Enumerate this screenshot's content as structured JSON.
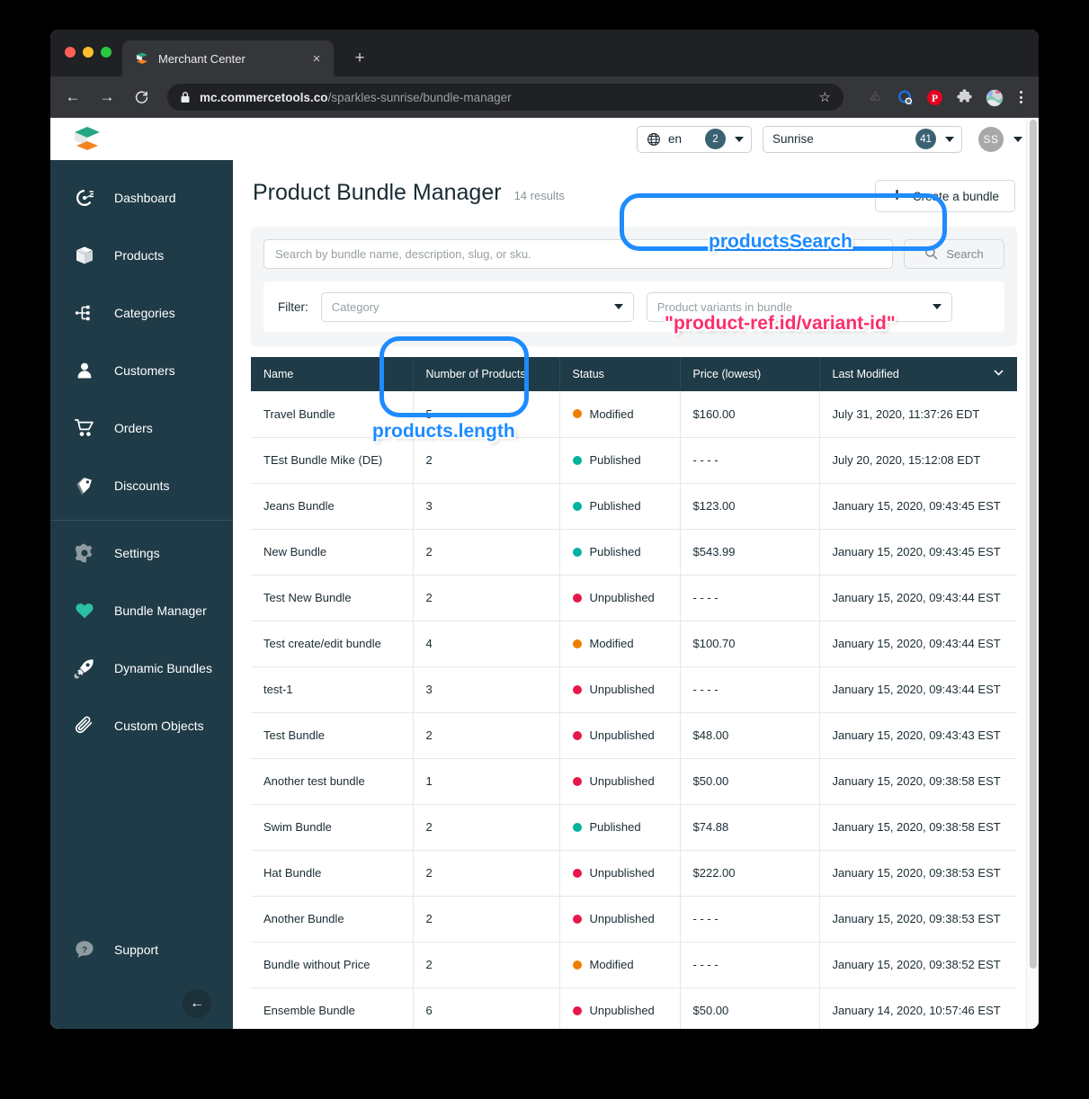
{
  "browser": {
    "tab": {
      "title": "Merchant Center",
      "favicon": "commercetools-logo-icon",
      "close": "×"
    },
    "new_tab_label": "+",
    "nav": {
      "back": "←",
      "forward": "→",
      "reload": "↻"
    },
    "url": {
      "domain": "mc.commercetools.co",
      "path": "/sparkles-sunrise/bundle-manager"
    },
    "extensions": [
      "recycle-icon",
      "search-lens-icon",
      "pinterest-icon",
      "puzzle-extension-icon",
      "profile-avatar-icon"
    ],
    "star_icon": "☆"
  },
  "app_header": {
    "logo": "commercetools-logo",
    "language": {
      "value": "en",
      "count": "2",
      "icon": "globe-icon"
    },
    "project": {
      "value": "Sunrise",
      "count": "41"
    },
    "user": {
      "initials": "SS"
    }
  },
  "sidebar": {
    "items": [
      {
        "label": "Dashboard",
        "icon": "gauge-icon",
        "active": false
      },
      {
        "label": "Products",
        "icon": "box-icon",
        "active": false
      },
      {
        "label": "Categories",
        "icon": "tree-icon",
        "active": false
      },
      {
        "label": "Customers",
        "icon": "person-icon",
        "active": false
      },
      {
        "label": "Orders",
        "icon": "cart-icon",
        "active": false
      },
      {
        "label": "Discounts",
        "icon": "tags-icon",
        "active": false
      },
      {
        "label": "Settings",
        "icon": "gear-icon",
        "active": false
      },
      {
        "label": "Bundle Manager",
        "icon": "heart-icon",
        "active": true
      },
      {
        "label": "Dynamic Bundles",
        "icon": "rocket-icon",
        "active": false
      },
      {
        "label": "Custom Objects",
        "icon": "paperclip-icon",
        "active": false
      }
    ],
    "support": {
      "label": "Support",
      "icon": "question-bubble-icon"
    },
    "collapse": {
      "icon": "arrow-left-icon",
      "glyph": "←"
    }
  },
  "main": {
    "title": "Product Bundle Manager",
    "results": "14 results",
    "create_button": {
      "label": "Create a bundle",
      "icon": "plus-icon",
      "glyph": "✚"
    },
    "search": {
      "placeholder": "Search by bundle name, description, slug, or sku.",
      "value": "",
      "button_label": "Search",
      "button_icon": "search-icon"
    },
    "filter": {
      "label": "Filter:",
      "category": {
        "placeholder": "Category",
        "value": "Category"
      },
      "variants": {
        "placeholder": "Product variants in bundle",
        "value": "Product variants in bundle"
      }
    },
    "table": {
      "columns": [
        "Name",
        "Number of Products",
        "Status",
        "Price (lowest)",
        "Last Modified"
      ],
      "sort_icon": "chevron-down-icon",
      "status_colors": {
        "Modified": "#f07d00",
        "Published": "#00b39e",
        "Unpublished": "#e8174a"
      },
      "rows": [
        {
          "name": "Travel Bundle",
          "products": "5",
          "status": "Modified",
          "price": "$160.00",
          "modified": "July 31, 2020, 11:37:26 EDT"
        },
        {
          "name": "TEst Bundle Mike (DE)",
          "products": "2",
          "status": "Published",
          "price": "- - - -",
          "modified": "July 20, 2020, 15:12:08 EDT"
        },
        {
          "name": "Jeans Bundle",
          "products": "3",
          "status": "Published",
          "price": "$123.00",
          "modified": "January 15, 2020, 09:43:45 EST"
        },
        {
          "name": "New Bundle",
          "products": "2",
          "status": "Published",
          "price": "$543.99",
          "modified": "January 15, 2020, 09:43:45 EST"
        },
        {
          "name": "Test New Bundle",
          "products": "2",
          "status": "Unpublished",
          "price": "- - - -",
          "modified": "January 15, 2020, 09:43:44 EST"
        },
        {
          "name": "Test create/edit bundle",
          "products": "4",
          "status": "Modified",
          "price": "$100.70",
          "modified": "January 15, 2020, 09:43:44 EST"
        },
        {
          "name": "test-1",
          "products": "3",
          "status": "Unpublished",
          "price": "- - - -",
          "modified": "January 15, 2020, 09:43:44 EST"
        },
        {
          "name": "Test Bundle",
          "products": "2",
          "status": "Unpublished",
          "price": "$48.00",
          "modified": "January 15, 2020, 09:43:43 EST"
        },
        {
          "name": "Another test bundle",
          "products": "1",
          "status": "Unpublished",
          "price": "$50.00",
          "modified": "January 15, 2020, 09:38:58 EST"
        },
        {
          "name": "Swim Bundle",
          "products": "2",
          "status": "Published",
          "price": "$74.88",
          "modified": "January 15, 2020, 09:38:58 EST"
        },
        {
          "name": "Hat Bundle",
          "products": "2",
          "status": "Unpublished",
          "price": "$222.00",
          "modified": "January 15, 2020, 09:38:53 EST"
        },
        {
          "name": "Another Bundle",
          "products": "2",
          "status": "Unpublished",
          "price": "- - - -",
          "modified": "January 15, 2020, 09:38:53 EST"
        },
        {
          "name": "Bundle without Price",
          "products": "2",
          "status": "Modified",
          "price": "- - - -",
          "modified": "January 15, 2020, 09:38:52 EST"
        },
        {
          "name": "Ensemble Bundle",
          "products": "6",
          "status": "Unpublished",
          "price": "$50.00",
          "modified": "January 14, 2020, 10:57:46 EST"
        }
      ]
    }
  },
  "annotations": [
    {
      "text": "productsSearch",
      "color": "#1e8bff"
    },
    {
      "text": "\"product-ref.id/variant-id\"",
      "color": "#fb2f6b"
    },
    {
      "text": "products.length",
      "color": "#1e8bff"
    }
  ]
}
